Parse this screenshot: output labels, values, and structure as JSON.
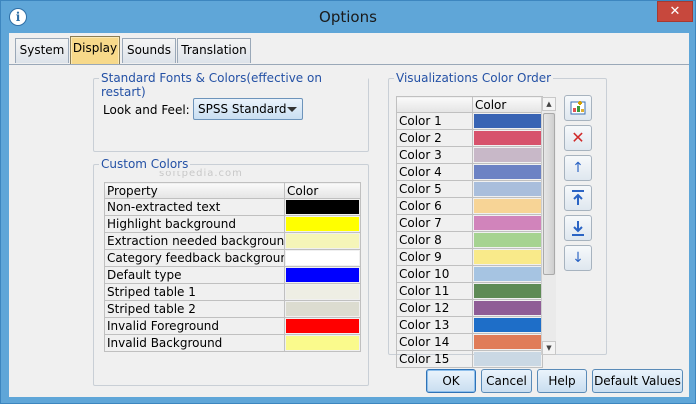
{
  "window": {
    "title": "Options",
    "close_label": "✕"
  },
  "tabs": [
    {
      "label": "System",
      "active": false
    },
    {
      "label": "Display",
      "active": true
    },
    {
      "label": "Sounds",
      "active": false
    },
    {
      "label": "Translation",
      "active": false
    }
  ],
  "fonts_group": {
    "title": "Standard Fonts & Colors(effective on restart)",
    "look_feel_label": "Look and Feel:",
    "look_feel_value": "SPSS Standard"
  },
  "watermark": "softpedia.com",
  "custom_colors": {
    "title": "Custom Colors",
    "headers": [
      "Property",
      "Color"
    ],
    "rows": [
      {
        "property": "Non-extracted text",
        "color": "#000000"
      },
      {
        "property": "Highlight background",
        "color": "#ffff00"
      },
      {
        "property": "Extraction needed background",
        "color": "#f5f5b8"
      },
      {
        "property": "Category feedback background",
        "color": "#ffffff"
      },
      {
        "property": "Default type",
        "color": "#0000ff"
      },
      {
        "property": "Striped table 1",
        "color": "#eeeee4"
      },
      {
        "property": "Striped table 2",
        "color": "#dcdcd0"
      },
      {
        "property": "Invalid Foreground",
        "color": "#ff0000"
      },
      {
        "property": "Invalid Background",
        "color": "#fafa8c"
      }
    ]
  },
  "viz_colors": {
    "title": "Visualizations Color Order",
    "headers": [
      "",
      "Color"
    ],
    "rows": [
      {
        "name": "Color 1",
        "color": "#3964b4"
      },
      {
        "name": "Color 2",
        "color": "#d7526c"
      },
      {
        "name": "Color 3",
        "color": "#c8b8c8"
      },
      {
        "name": "Color 4",
        "color": "#6c82c4"
      },
      {
        "name": "Color 5",
        "color": "#a9bedc"
      },
      {
        "name": "Color 6",
        "color": "#f7d496"
      },
      {
        "name": "Color 7",
        "color": "#d184bb"
      },
      {
        "name": "Color 8",
        "color": "#a6d391"
      },
      {
        "name": "Color 9",
        "color": "#f9ea8a"
      },
      {
        "name": "Color 10",
        "color": "#a6c4e2"
      },
      {
        "name": "Color 11",
        "color": "#5e8b55"
      },
      {
        "name": "Color 12",
        "color": "#8f5d96"
      },
      {
        "name": "Color 13",
        "color": "#1e6ec8"
      },
      {
        "name": "Color 14",
        "color": "#e07c58"
      },
      {
        "name": "Color 15",
        "color": "#cad8e4"
      }
    ]
  },
  "side_buttons": [
    "add-icon",
    "delete-icon",
    "move-up-icon",
    "move-top-icon",
    "move-bottom-icon",
    "move-down-icon"
  ],
  "buttons": {
    "ok": "OK",
    "cancel": "Cancel",
    "help": "Help",
    "default": "Default Values"
  }
}
